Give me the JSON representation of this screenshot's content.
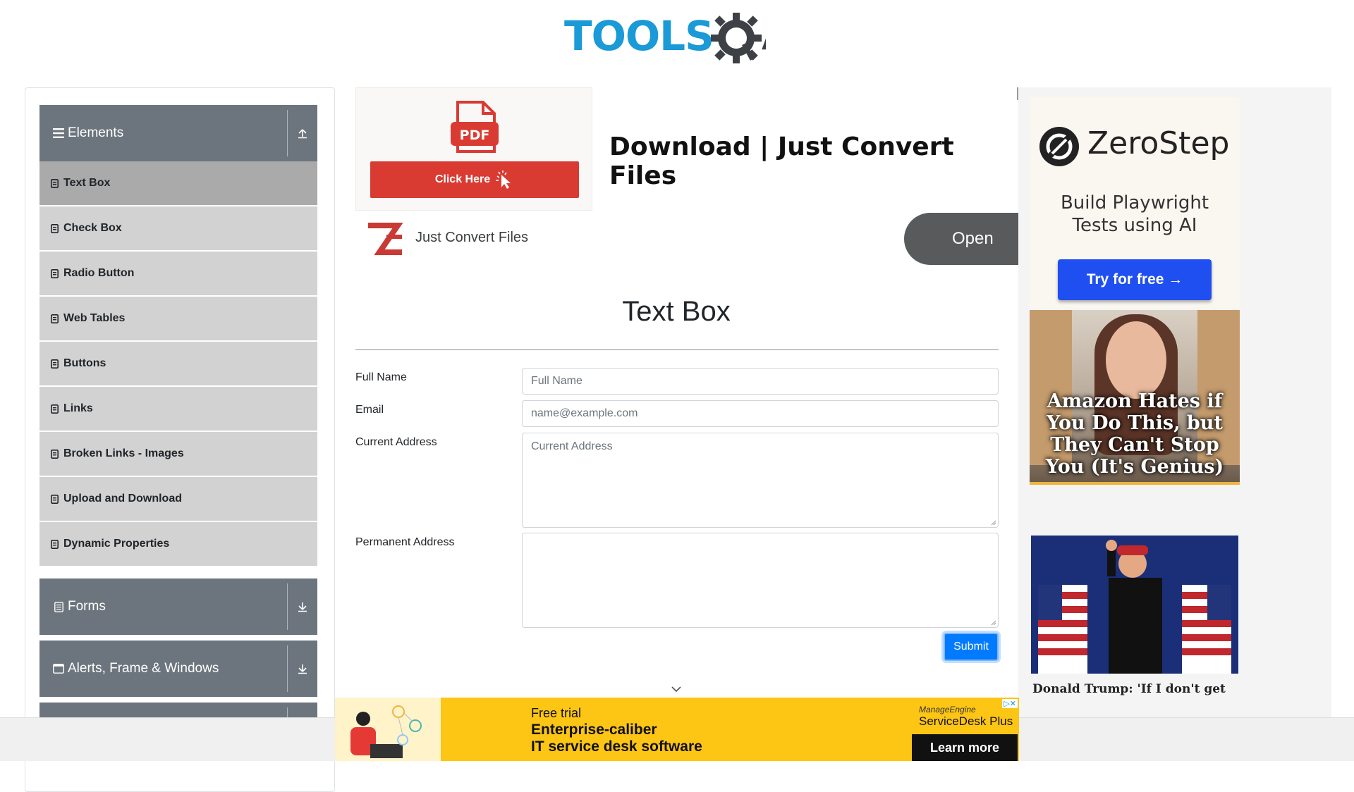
{
  "logo": {
    "tools": "TOOLS",
    "qa": "QA"
  },
  "sidebar": {
    "elements_title": "Elements",
    "items": [
      {
        "label": "Text Box"
      },
      {
        "label": "Check Box"
      },
      {
        "label": "Radio Button"
      },
      {
        "label": "Web Tables"
      },
      {
        "label": "Buttons"
      },
      {
        "label": "Links"
      },
      {
        "label": "Broken Links - Images"
      },
      {
        "label": "Upload and Download"
      },
      {
        "label": "Dynamic Properties"
      }
    ],
    "forms_title": "Forms",
    "alerts_title": "Alerts, Frame & Windows"
  },
  "ad_top": {
    "pdf_label": "PDF",
    "click_here": "Click Here",
    "headline": "Download | Just Convert Files",
    "brand": "Just Convert Files",
    "open": "Open"
  },
  "main": {
    "title": "Text Box",
    "full_name_label": "Full Name",
    "full_name_placeholder": "Full Name",
    "email_label": "Email",
    "email_placeholder": "name@example.com",
    "current_address_label": "Current Address",
    "current_address_placeholder": "Current Address",
    "permanent_address_label": "Permanent Address",
    "submit": "Submit"
  },
  "right_ads": {
    "zerostep_name": "ZeroStep",
    "zerostep_tag_line1": "Build Playwright",
    "zerostep_tag_line2": "Tests using AI",
    "zerostep_button": "Try for free →",
    "amazon_caption": "Amazon Hates if You Do This, but They Can't Stop You (It's Genius)",
    "trump_caption": "Donald Trump: 'If I don't get"
  },
  "bottom_ad": {
    "free_trial": "Free trial",
    "headline_line1": "Enterprise-caliber",
    "headline_line2": "IT service desk software",
    "brand_small": "ManageEngine",
    "brand": "ServiceDesk Plus",
    "cta": "Learn more"
  },
  "colors": {
    "accent": "#007bff",
    "sidebar_header": "#6c757d",
    "menu_item": "#d2d2d2",
    "menu_item_active": "#aaaaaa"
  }
}
